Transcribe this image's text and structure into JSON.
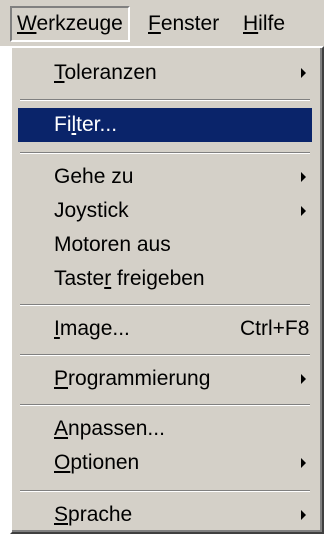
{
  "menubar": {
    "items": [
      {
        "prefix": "",
        "accel": "W",
        "rest": "erkzeuge"
      },
      {
        "prefix": "",
        "accel": "F",
        "rest": "enster"
      },
      {
        "prefix": "",
        "accel": "H",
        "rest": "ilfe"
      }
    ]
  },
  "menu": {
    "items": [
      {
        "prefix": "",
        "accel": "T",
        "rest": "oleranzen",
        "shortcut": "",
        "submenu": true
      },
      {
        "prefix": "Fi",
        "accel": "l",
        "rest": "ter...",
        "shortcut": "",
        "submenu": false,
        "highlighted": true
      },
      {
        "prefix": "Gehe zu",
        "accel": "",
        "rest": "",
        "shortcut": "",
        "submenu": true
      },
      {
        "prefix": "Joystick",
        "accel": "",
        "rest": "",
        "shortcut": "",
        "submenu": true
      },
      {
        "prefix": "Motoren aus",
        "accel": "",
        "rest": "",
        "shortcut": "",
        "submenu": false
      },
      {
        "prefix": "Taste",
        "accel": "r",
        "rest": " freigeben",
        "shortcut": "",
        "submenu": false
      },
      {
        "prefix": "",
        "accel": "I",
        "rest": "mage...",
        "shortcut": "Ctrl+F8",
        "submenu": false
      },
      {
        "prefix": "",
        "accel": "P",
        "rest": "rogrammierung",
        "shortcut": "",
        "submenu": true
      },
      {
        "prefix": "",
        "accel": "A",
        "rest": "npassen...",
        "shortcut": "",
        "submenu": false
      },
      {
        "prefix": "",
        "accel": "O",
        "rest": "ptionen",
        "shortcut": "",
        "submenu": true
      },
      {
        "prefix": "",
        "accel": "S",
        "rest": "prache",
        "shortcut": "",
        "submenu": true
      }
    ]
  }
}
